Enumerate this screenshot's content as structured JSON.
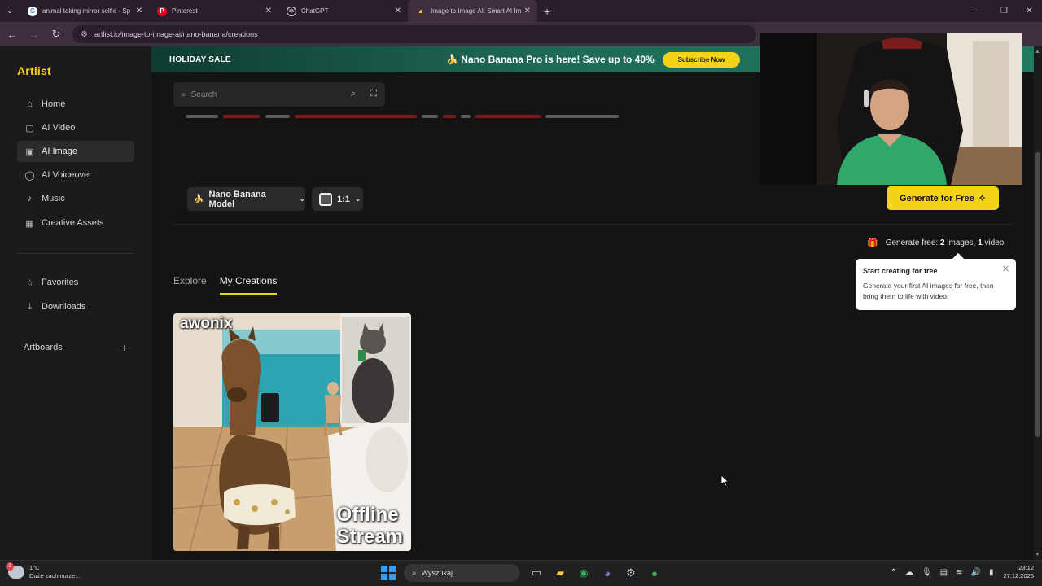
{
  "browser": {
    "tabs": [
      {
        "title": "animal taking mirror selfie - Sp",
        "icon": "google-icon",
        "color": "#4285f4"
      },
      {
        "title": "Pinterest",
        "icon": "pinterest-icon",
        "color": "#e60023"
      },
      {
        "title": "ChatGPT",
        "icon": "chatgpt-icon",
        "color": "#dcdcdc"
      },
      {
        "title": "Image to Image AI: Smart AI Im",
        "icon": "artlist-icon",
        "color": "#f3d318"
      }
    ],
    "active_tab": 3,
    "url": "artlist.io/image-to-image-ai/nano-banana/creations"
  },
  "sidebar": {
    "logo": "Artlist",
    "items": [
      {
        "label": "Home",
        "icon": "home-icon",
        "glyph": "⌂"
      },
      {
        "label": "AI Video",
        "icon": "ai-video-icon",
        "glyph": "▢"
      },
      {
        "label": "AI Image",
        "icon": "ai-image-icon",
        "glyph": "▣"
      },
      {
        "label": "AI Voiceover",
        "icon": "ai-voiceover-icon",
        "glyph": "◯"
      },
      {
        "label": "Music",
        "icon": "music-icon",
        "glyph": "♪"
      },
      {
        "label": "Creative Assets",
        "icon": "creative-assets-icon",
        "glyph": "▦"
      }
    ],
    "active_item": "AI Image",
    "secondary": [
      {
        "label": "Favorites",
        "icon": "star-icon",
        "glyph": "☆"
      },
      {
        "label": "Downloads",
        "icon": "download-icon",
        "glyph": "⤓"
      }
    ],
    "artboards": {
      "label": "Artboards",
      "add": "+"
    }
  },
  "promo": {
    "sale": "HOLIDAY SALE",
    "message": "🍌 Nano Banana Pro is here! Save up to 40%",
    "cta": "Subscribe Now"
  },
  "search": {
    "placeholder": "Search"
  },
  "generator": {
    "model": "Nano Banana Model",
    "ratio": "1:1",
    "generate": "Generate for Free",
    "free_prefix": "Generate free: ",
    "free_images": "2",
    "free_images_unit": " images, ",
    "free_videos": "1",
    "free_videos_unit": " video"
  },
  "tooltip": {
    "title": "Start creating for free",
    "body": "Generate your first AI images for free, then bring them to life with video."
  },
  "tabs": [
    {
      "label": "Explore",
      "selected": false
    },
    {
      "label": "My Creations",
      "selected": true
    }
  ],
  "creation": {
    "caption_top": "awonix",
    "caption_bottom_1": "Offline",
    "caption_bottom_2": "Stream"
  },
  "taskbar": {
    "weather_temp": "1°C",
    "weather_desc": "Duże zachmurze...",
    "weather_badge": "2",
    "search": "Wyszukaj",
    "time": "23:12",
    "date": "27.12.2025"
  },
  "colors": {
    "accent": "#f3d318",
    "promo": "#1f6a57",
    "background": "#141414"
  }
}
